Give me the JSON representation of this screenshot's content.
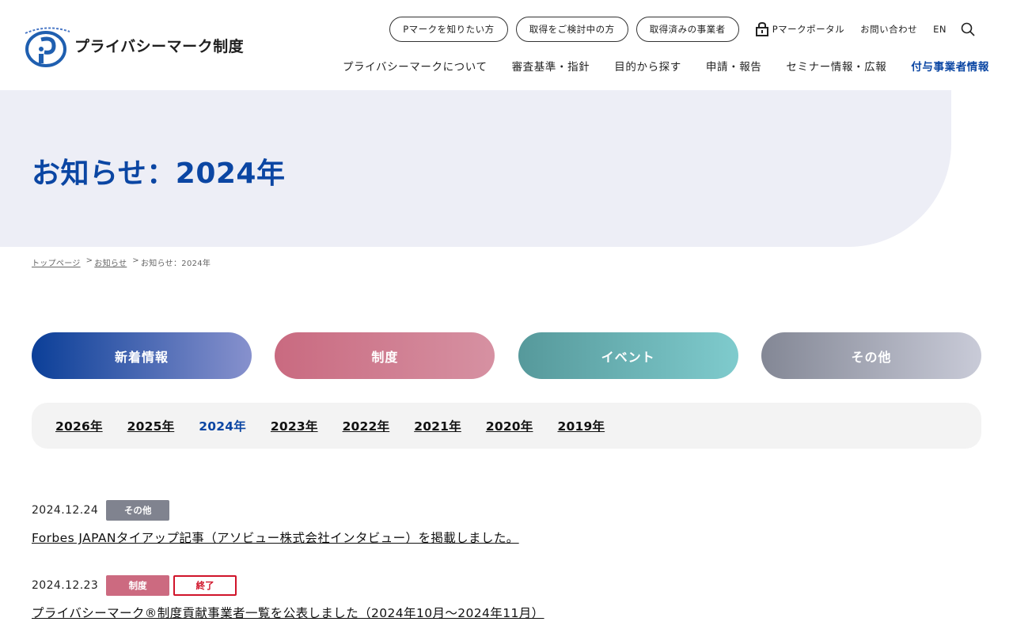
{
  "header": {
    "logo_text": "プライバシーマーク制度",
    "logo_mark_text": "たいせつにしますプライバシー",
    "top_links": [
      "Pマークを知りたい方",
      "取得をご検討中の方",
      "取得済みの事業者"
    ],
    "portal_label": "Pマークポータル",
    "contact_label": "お問い合わせ",
    "lang_label": "EN",
    "nav": [
      "プライバシーマークについて",
      "審査基準・指針",
      "目的から探す",
      "申請・報告",
      "セミナー情報・広報",
      "付与事業者情報"
    ]
  },
  "hero": {
    "title": "お知らせ：2024年"
  },
  "breadcrumb": {
    "home": "トップページ",
    "news": "お知らせ",
    "current": "お知らせ：2024年",
    "sep": ">"
  },
  "categories": [
    "新着情報",
    "制度",
    "イベント",
    "その他"
  ],
  "years": [
    "2026年",
    "2025年",
    "2024年",
    "2023年",
    "2022年",
    "2021年",
    "2020年",
    "2019年"
  ],
  "active_year": "2024年",
  "news": [
    {
      "date": "2024.12.24",
      "tags": [
        "その他"
      ],
      "title": "Forbes JAPANタイアップ記事（アソビュー株式会社インタビュー）を掲載しました。"
    },
    {
      "date": "2024.12.23",
      "tags": [
        "制度",
        "終了"
      ],
      "title": "プライバシーマーク®制度貢献事業者一覧を公表しました（2024年10月～2024年11月）"
    }
  ],
  "colors": {
    "accent": "#0b46a3",
    "hero_bg": "#edeef6",
    "tag_end": "#d0142a"
  }
}
